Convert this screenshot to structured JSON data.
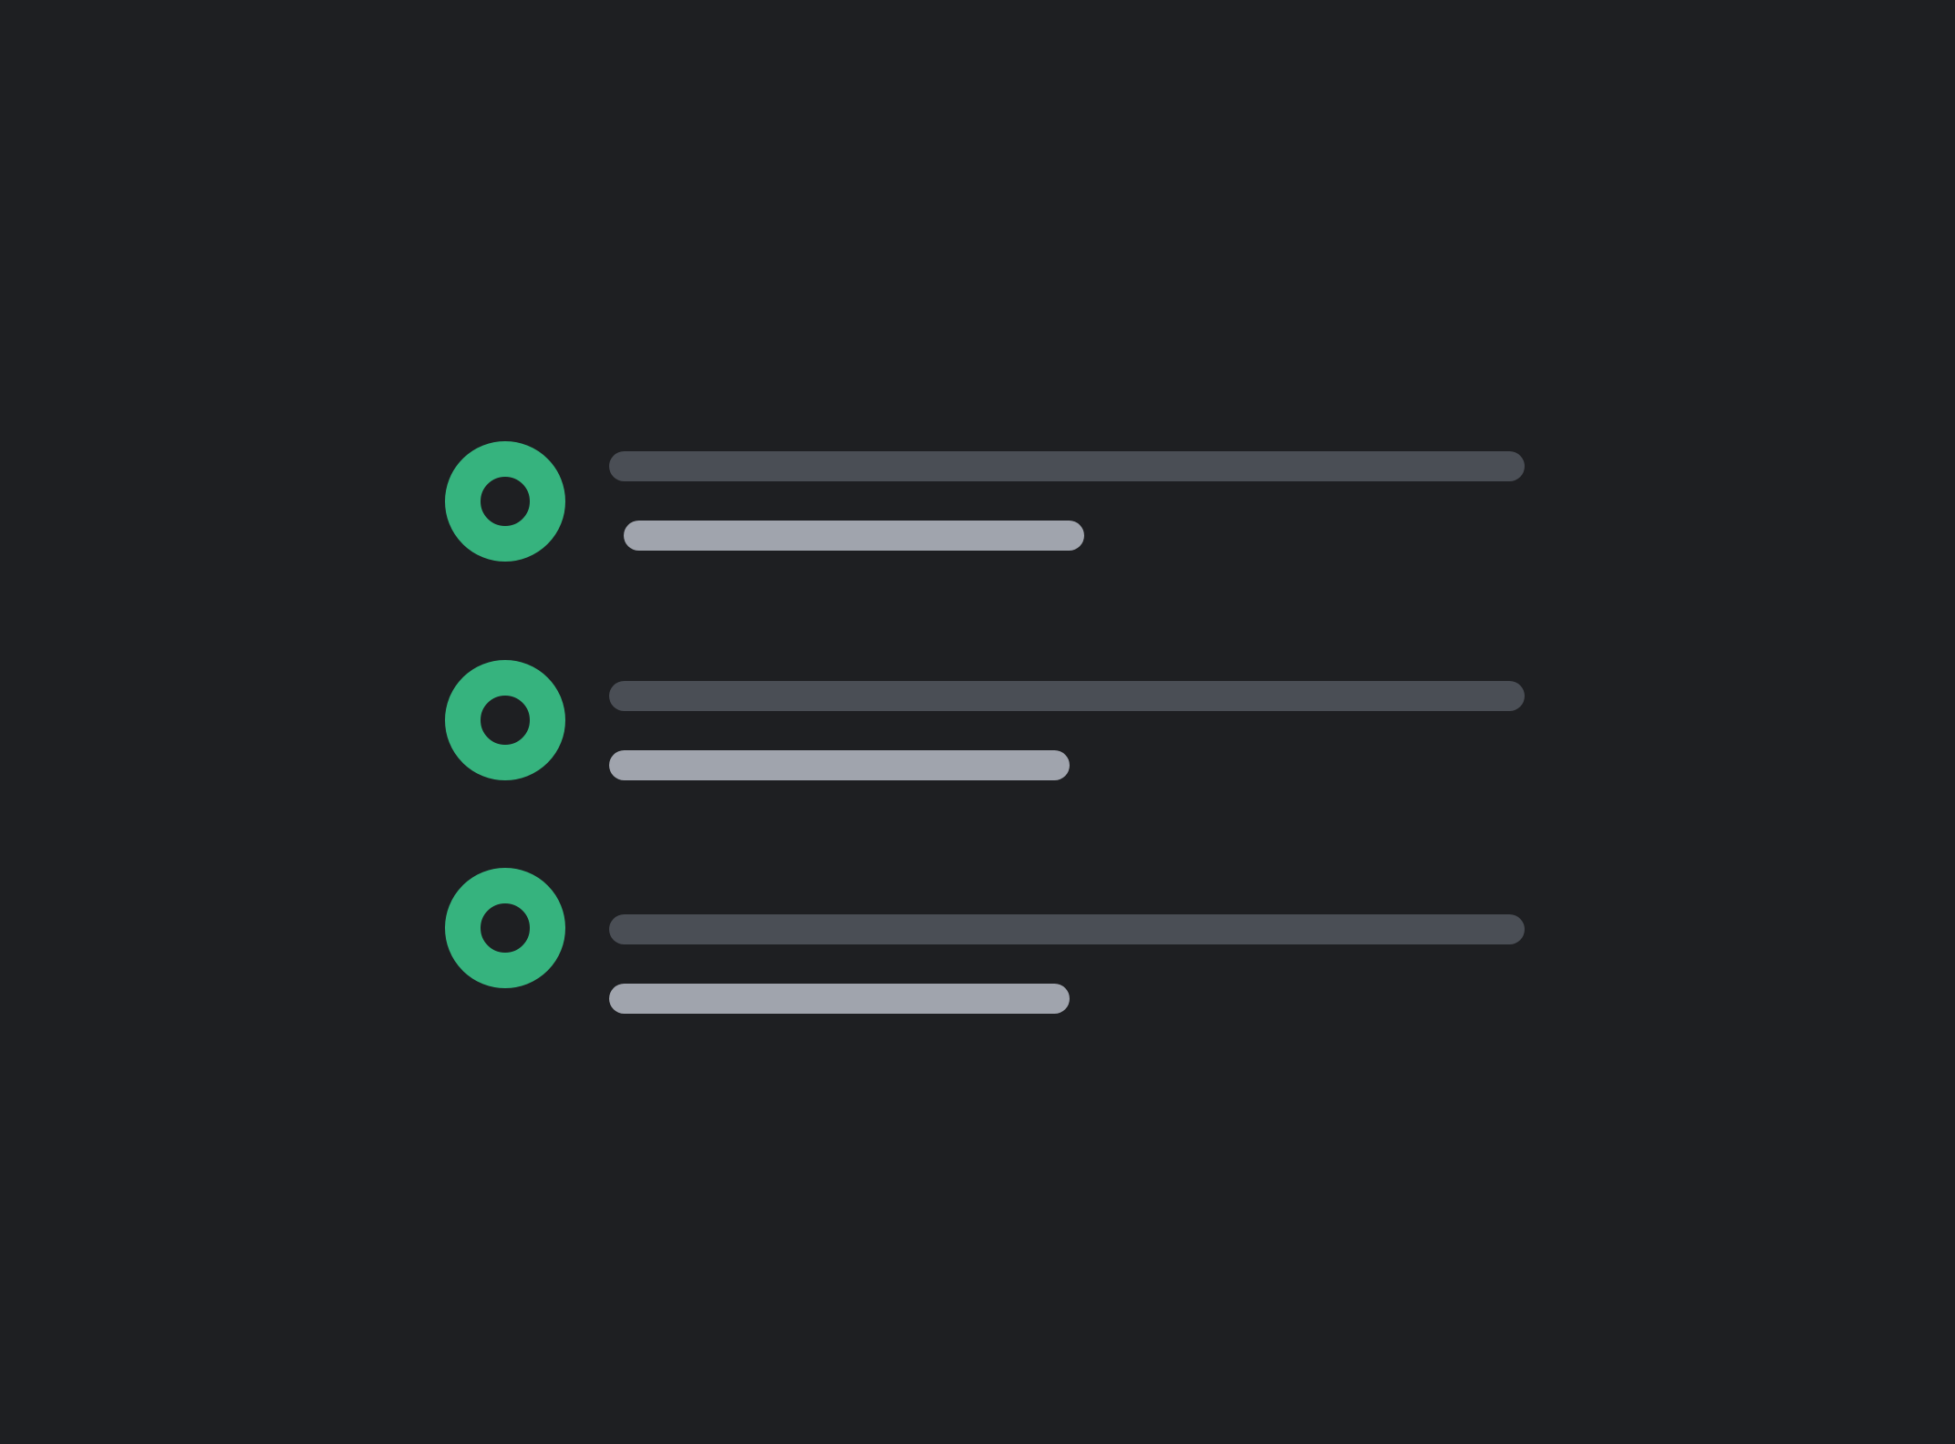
{
  "colors": {
    "background": "#1e1f22",
    "status_ring": "#36b37e",
    "primary_bar": "#4a4e55",
    "secondary_bar": "#a0a4ad"
  },
  "skeleton_list": {
    "items": [
      {
        "status_icon": "ring-status-icon"
      },
      {
        "status_icon": "ring-status-icon"
      },
      {
        "status_icon": "ring-status-icon"
      }
    ]
  }
}
